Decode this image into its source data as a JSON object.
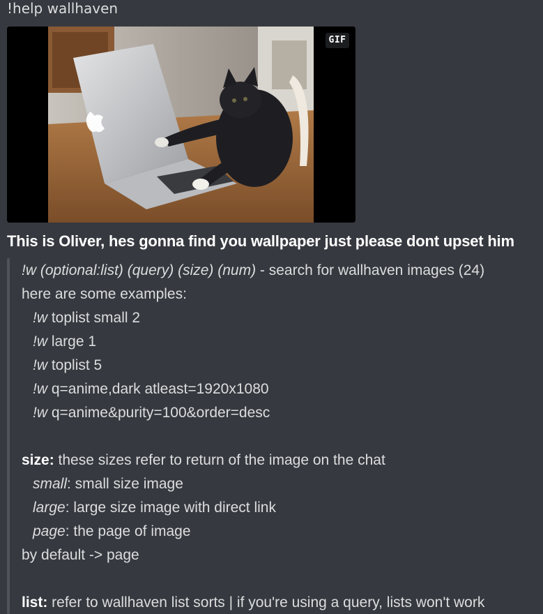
{
  "message": {
    "command_text": "!help wallhaven"
  },
  "gif": {
    "badge_label": "GIF",
    "subject": "cat typing on laptop"
  },
  "embed": {
    "title": "This is Oliver, hes gonna find you wallpaper just please dont upset him",
    "usage": {
      "prefix": "!w",
      "args": "(optional:list) (query) (size) (num)",
      "description": " - search for wallhaven images (24)"
    },
    "examples_header": "here are some examples:",
    "examples": [
      {
        "prefix": "!w",
        "rest": " toplist small 2"
      },
      {
        "prefix": "!w",
        "rest": " large 1"
      },
      {
        "prefix": "!w",
        "rest": " toplist 5"
      },
      {
        "prefix": "!w",
        "rest": " q=anime,dark atleast=1920x1080"
      },
      {
        "prefix": "!w",
        "rest": " q=anime&purity=100&order=desc"
      }
    ],
    "size_section": {
      "label": "size:",
      "text": " these sizes refer to return of the image on the chat",
      "options": [
        {
          "name": "small",
          "text": ": small size image"
        },
        {
          "name": "large",
          "text": ": large size image with direct link"
        },
        {
          "name": "page",
          "text": ":  the page of image"
        }
      ],
      "default_text": "by default -> page"
    },
    "list_section": {
      "label": "list:",
      "text": " refer to wallhaven list sorts | if you're using a query, lists won't work"
    }
  },
  "colors": {
    "background": "#36393f",
    "text": "#dcddde",
    "title": "#ffffff",
    "quote_bar": "#4f545c"
  }
}
